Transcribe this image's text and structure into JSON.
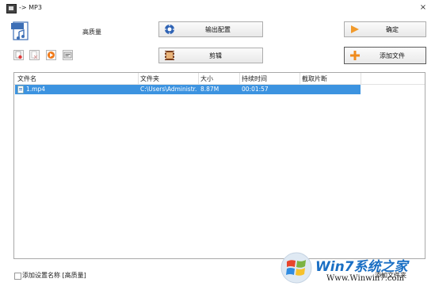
{
  "window": {
    "title": "-> MP3",
    "close": "×"
  },
  "preset": {
    "label": "高质量"
  },
  "buttons": {
    "output_config": "输出配置",
    "edit": "剪辑",
    "confirm": "确定",
    "add_file": "添加文件"
  },
  "toolbar": {
    "icons": [
      "add-icon",
      "remove-icon",
      "play-icon",
      "info-icon"
    ]
  },
  "table": {
    "headers": [
      "文件名",
      "文件夹",
      "大小",
      "持续时间",
      "截取片断"
    ],
    "rows": [
      {
        "name": "1.mp4",
        "folder": "C:\\Users\\Administr...",
        "size": "8.87M",
        "duration": "00:01:57",
        "clip": ""
      }
    ]
  },
  "footer": {
    "checkbox_label": "添加设置名称 [高质量]",
    "add_folder": "添加文件夹"
  },
  "watermark": {
    "brand": "Win7系统之家",
    "url": "Www.Winwin7.com"
  }
}
